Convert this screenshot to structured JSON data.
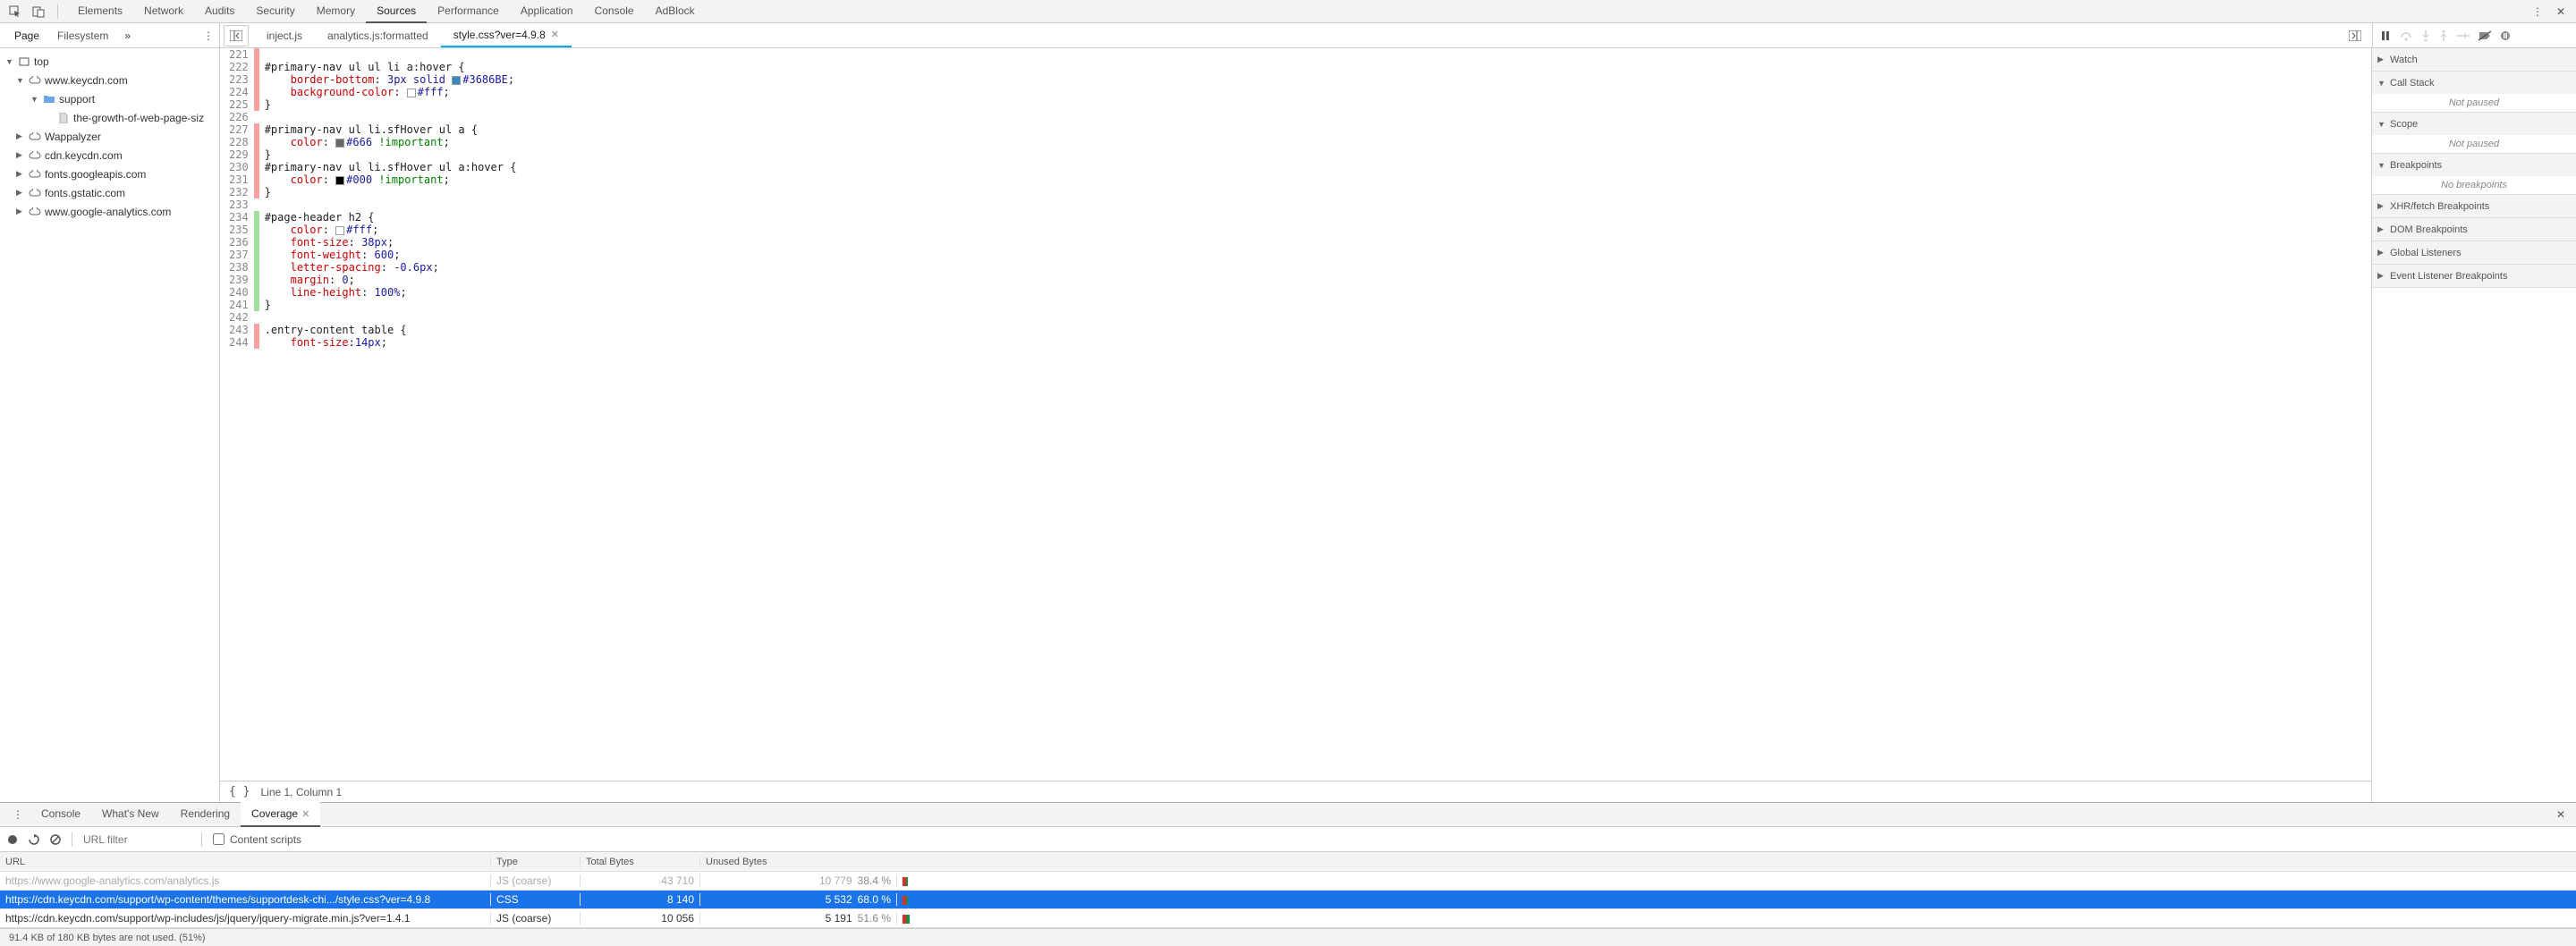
{
  "topTabs": [
    "Elements",
    "Network",
    "Audits",
    "Security",
    "Memory",
    "Sources",
    "Performance",
    "Application",
    "Console",
    "AdBlock"
  ],
  "topActive": "Sources",
  "navTabs": {
    "items": [
      "Page",
      "Filesystem"
    ],
    "active": "Page",
    "more": "»"
  },
  "fileTabs": [
    {
      "label": "inject.js",
      "active": false,
      "closable": false
    },
    {
      "label": "analytics.js:formatted",
      "active": false,
      "closable": false
    },
    {
      "label": "style.css?ver=4.9.8",
      "active": true,
      "closable": true
    }
  ],
  "tree": [
    {
      "depth": 0,
      "arrow": "▼",
      "icon": "frame",
      "label": "top"
    },
    {
      "depth": 1,
      "arrow": "▼",
      "icon": "cloud",
      "label": "www.keycdn.com"
    },
    {
      "depth": 2,
      "arrow": "▼",
      "icon": "folder",
      "label": "support"
    },
    {
      "depth": 3,
      "arrow": "",
      "icon": "file",
      "label": "the-growth-of-web-page-siz"
    },
    {
      "depth": 1,
      "arrow": "▶",
      "icon": "cloud",
      "label": "Wappalyzer"
    },
    {
      "depth": 1,
      "arrow": "▶",
      "icon": "cloud",
      "label": "cdn.keycdn.com"
    },
    {
      "depth": 1,
      "arrow": "▶",
      "icon": "cloud",
      "label": "fonts.googleapis.com"
    },
    {
      "depth": 1,
      "arrow": "▶",
      "icon": "cloud",
      "label": "fonts.gstatic.com"
    },
    {
      "depth": 1,
      "arrow": "▶",
      "icon": "cloud",
      "label": "www.google-analytics.com"
    }
  ],
  "code": {
    "start": 221,
    "lines": [
      {
        "mk": "red",
        "html": ""
      },
      {
        "mk": "red",
        "html": "<span class='tok-sel'>#primary-nav ul ul li a:hover</span> {"
      },
      {
        "mk": "red",
        "html": "    <span class='tok-prop'>border-bottom</span>: <span class='tok-num'>3px</span> <span class='tok-kw'>solid</span> <span class='swatch' style='background:#3686BE'></span><span class='tok-hex'>#3686BE</span>;"
      },
      {
        "mk": "red",
        "html": "    <span class='tok-prop'>background-color</span>: <span class='swatch' style='background:#fff'></span><span class='tok-hex'>#fff</span>;"
      },
      {
        "mk": "red",
        "html": "}"
      },
      {
        "mk": "",
        "html": ""
      },
      {
        "mk": "red",
        "html": "<span class='tok-sel'>#primary-nav ul li.sfHover ul a</span> {"
      },
      {
        "mk": "red",
        "html": "    <span class='tok-prop'>color</span>: <span class='swatch' style='background:#666'></span><span class='tok-hex'>#666</span> <span class='tok-imp'>!important</span>;"
      },
      {
        "mk": "red",
        "html": "}"
      },
      {
        "mk": "red",
        "html": "<span class='tok-sel'>#primary-nav ul li.sfHover ul a:hover</span> {"
      },
      {
        "mk": "red",
        "html": "    <span class='tok-prop'>color</span>: <span class='swatch' style='background:#000'></span><span class='tok-hex'>#000</span> <span class='tok-imp'>!important</span>;"
      },
      {
        "mk": "red",
        "html": "}"
      },
      {
        "mk": "",
        "html": ""
      },
      {
        "mk": "green",
        "html": "<span class='tok-sel'>#page-header h2</span> {"
      },
      {
        "mk": "green",
        "html": "    <span class='tok-prop'>color</span>: <span class='swatch' style='background:#fff'></span><span class='tok-hex'>#fff</span>;"
      },
      {
        "mk": "green",
        "html": "    <span class='tok-prop'>font-size</span>: <span class='tok-num'>38px</span>;"
      },
      {
        "mk": "green",
        "html": "    <span class='tok-prop'>font-weight</span>: <span class='tok-num'>600</span>;"
      },
      {
        "mk": "green",
        "html": "    <span class='tok-prop'>letter-spacing</span>: <span class='tok-num'>-0.6px</span>;"
      },
      {
        "mk": "green",
        "html": "    <span class='tok-prop'>margin</span>: <span class='tok-num'>0</span>;"
      },
      {
        "mk": "green",
        "html": "    <span class='tok-prop'>line-height</span>: <span class='tok-num'>100%</span>;"
      },
      {
        "mk": "green",
        "html": "}"
      },
      {
        "mk": "",
        "html": ""
      },
      {
        "mk": "red",
        "html": "<span class='tok-sel'>.entry-content table</span> {"
      },
      {
        "mk": "red",
        "html": "    <span class='tok-prop'>font-size</span>:<span class='tok-num'>14px</span>;"
      }
    ]
  },
  "editorStatus": "Line 1, Column 1",
  "debugSections": [
    {
      "label": "Watch",
      "open": false,
      "body": ""
    },
    {
      "label": "Call Stack",
      "open": true,
      "body": "Not paused"
    },
    {
      "label": "Scope",
      "open": true,
      "body": "Not paused"
    },
    {
      "label": "Breakpoints",
      "open": true,
      "body": "No breakpoints"
    },
    {
      "label": "XHR/fetch Breakpoints",
      "open": false,
      "body": ""
    },
    {
      "label": "DOM Breakpoints",
      "open": false,
      "body": ""
    },
    {
      "label": "Global Listeners",
      "open": false,
      "body": ""
    },
    {
      "label": "Event Listener Breakpoints",
      "open": false,
      "body": ""
    }
  ],
  "drawer": {
    "tabs": [
      "Console",
      "What's New",
      "Rendering",
      "Coverage"
    ],
    "active": "Coverage",
    "toolbar": {
      "filterPlaceholder": "URL filter",
      "contentScripts": "Content scripts"
    },
    "headers": {
      "url": "URL",
      "type": "Type",
      "total": "Total Bytes",
      "unused": "Unused Bytes"
    },
    "rows": [
      {
        "url": "https://www.google-analytics.com/analytics.js",
        "type": "JS (coarse)",
        "total": "43 710",
        "unused": "10 779",
        "pct": "38.4 %",
        "faded": true,
        "sel": false
      },
      {
        "url": "https://cdn.keycdn.com/support/wp-content/themes/supportdesk-chi.../style.css?ver=4.9.8",
        "type": "CSS",
        "total": "8 140",
        "unused": "5 532",
        "pct": "68.0 %",
        "faded": false,
        "sel": true
      },
      {
        "url": "https://cdn.keycdn.com/support/wp-includes/js/jquery/jquery-migrate.min.js?ver=1.4.1",
        "type": "JS (coarse)",
        "total": "10 056",
        "unused": "5 191",
        "pct": "51.6 %",
        "faded": false,
        "sel": false
      }
    ]
  },
  "footer": "91.4 KB of 180 KB bytes are not used. (51%)"
}
